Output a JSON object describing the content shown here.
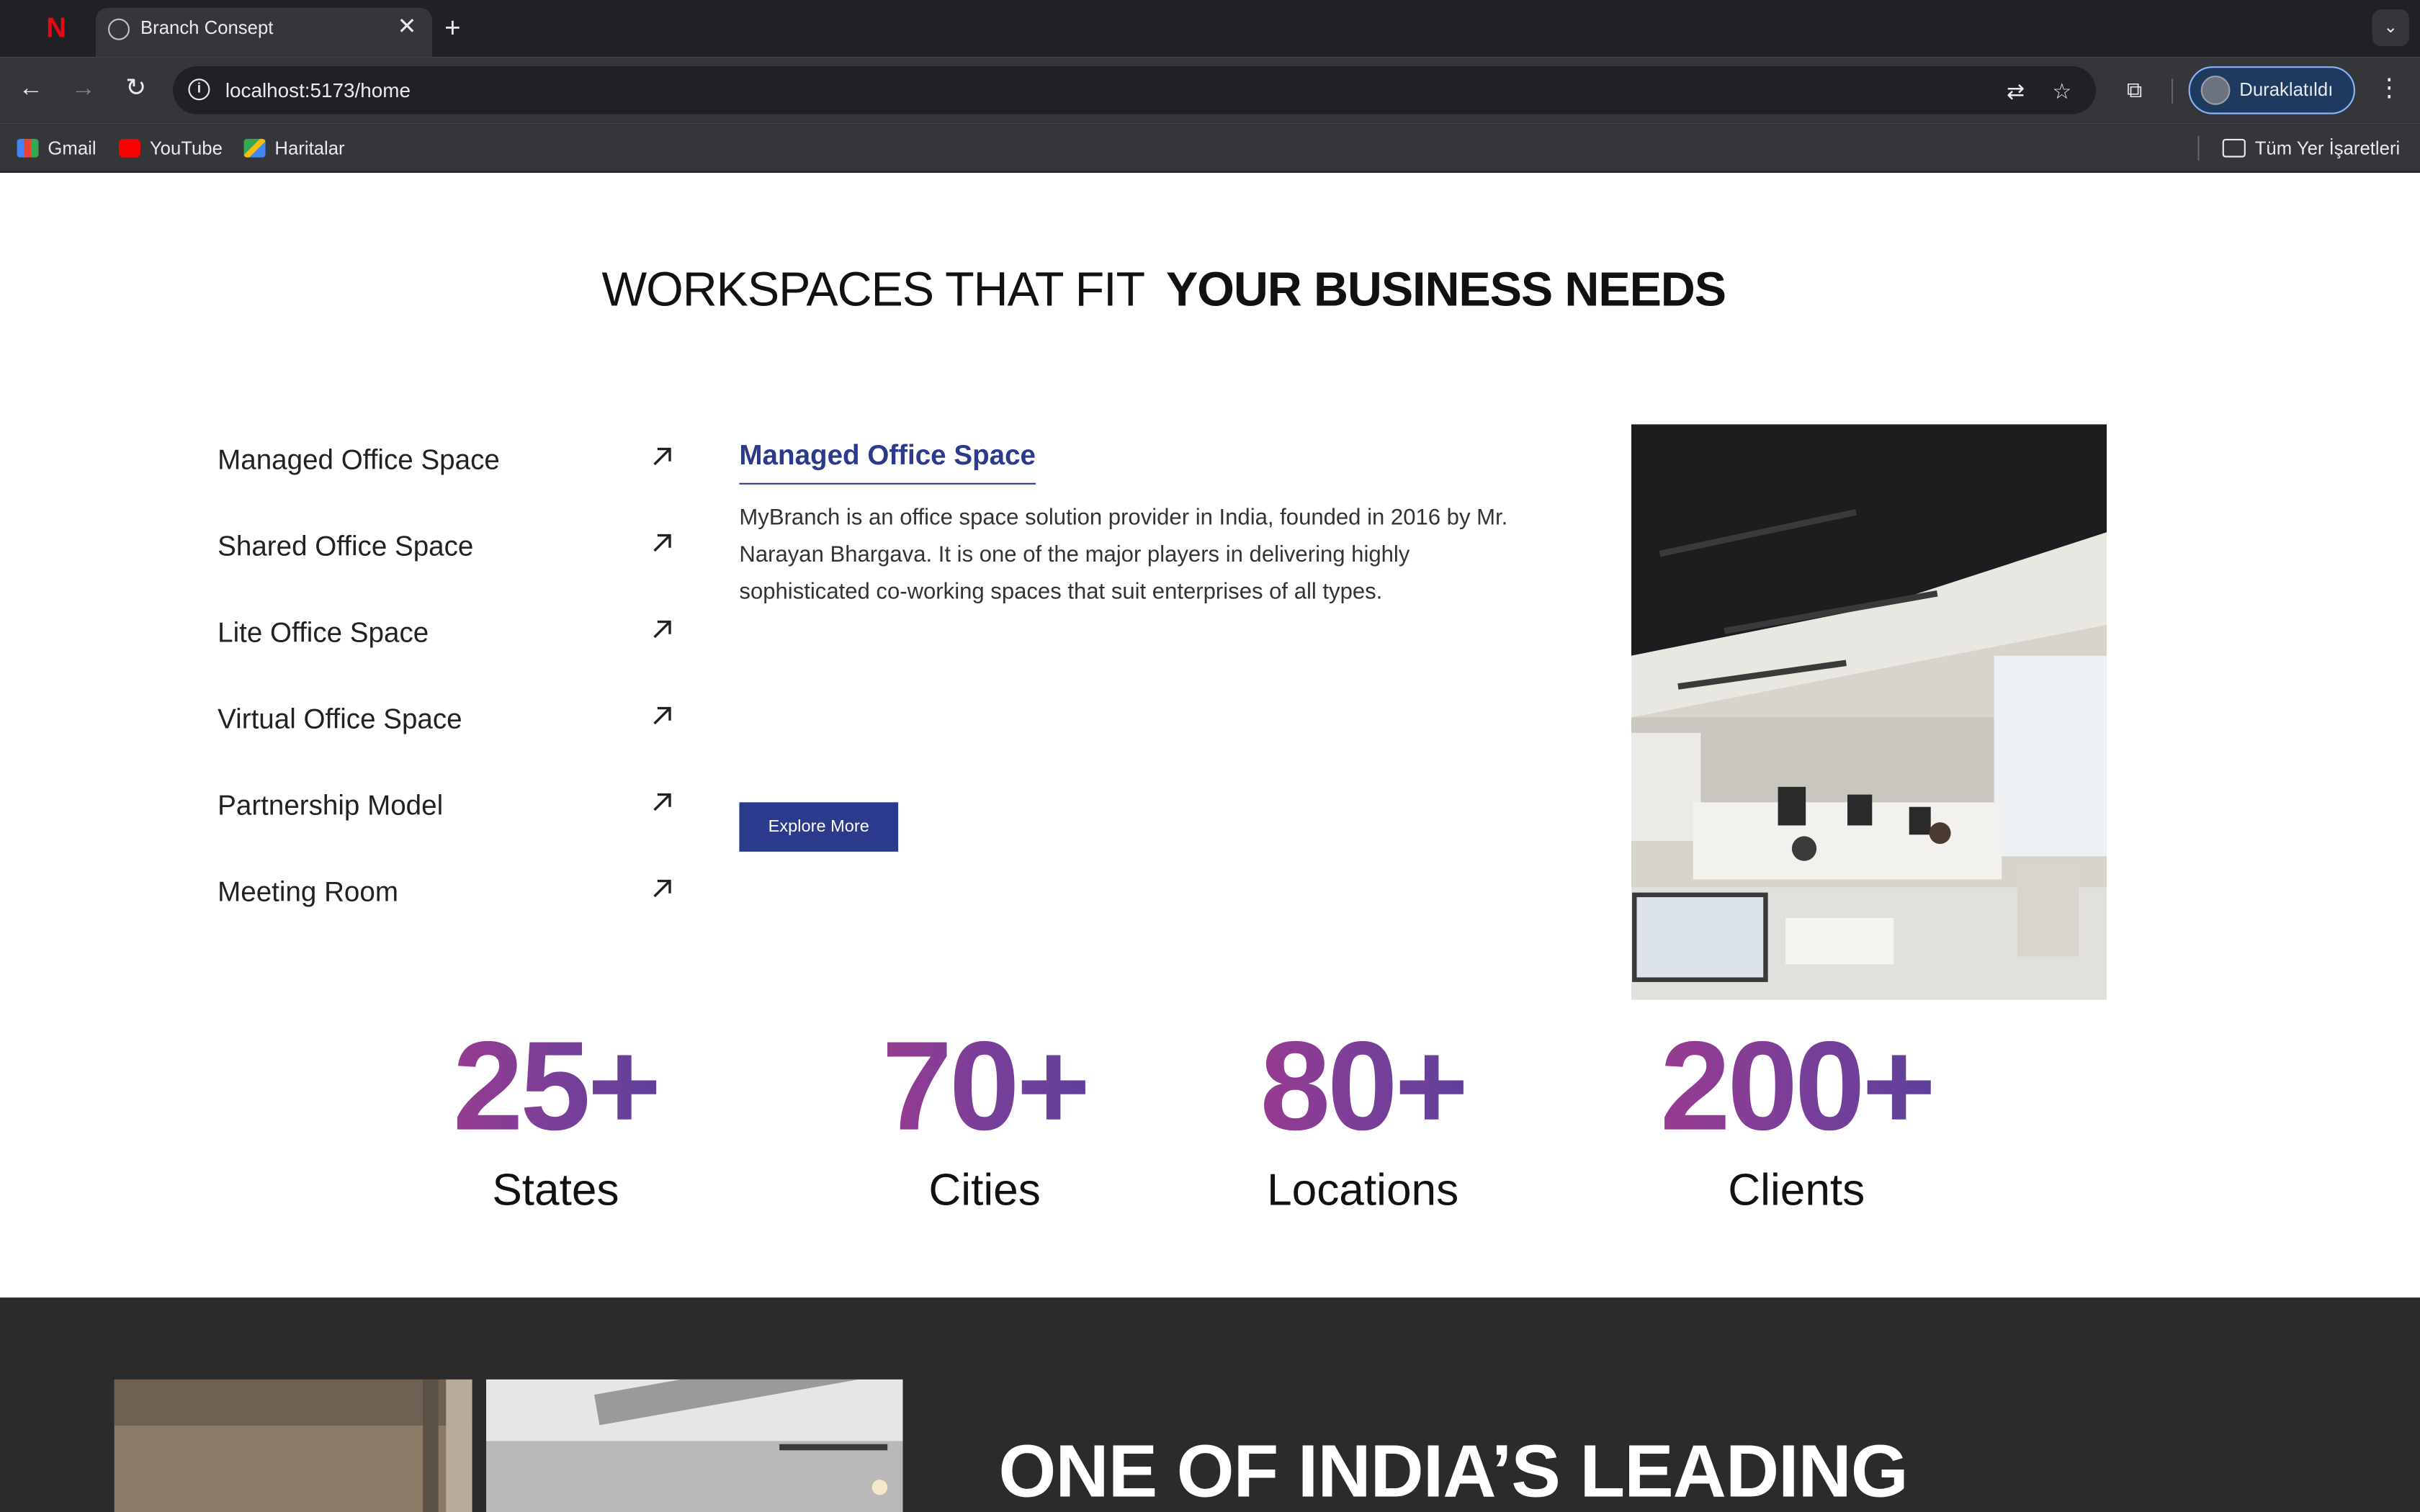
{
  "browser": {
    "tab_title": "Branch Consept",
    "url": "localhost:5173/home",
    "profile_label": "Duraklatıldı",
    "bookmarks": [
      "Gmail",
      "YouTube",
      "Haritalar"
    ],
    "all_bookmarks": "Tüm Yer İşaretleri"
  },
  "page": {
    "headline_light": "WORKSPACES THAT FIT",
    "headline_bold": "YOUR BUSINESS NEEDS",
    "menu": [
      "Managed Office Space",
      "Shared Office Space",
      "Lite Office Space",
      "Virtual Office Space",
      "Partnership Model",
      "Meeting Room"
    ],
    "detail": {
      "title": "Managed Office Space",
      "text": "MyBranch is an office space solution provider in India, founded in 2016 by Mr. Narayan Bhargava. It is one of the major players in delivering highly sophisticated co-working spaces that suit enterprises of all types.",
      "button": "Explore More"
    },
    "stats": [
      {
        "value": "25+",
        "label": "States"
      },
      {
        "value": "70+",
        "label": "Cities"
      },
      {
        "value": "80+",
        "label": "Locations"
      },
      {
        "value": "200+",
        "label": "Clients"
      }
    ],
    "section2_heading": "ONE OF INDIA’S LEADING"
  },
  "colors": {
    "accent": "#2b3a8c",
    "stat_gradient_start": "#a13a8c",
    "stat_gradient_end": "#55409a"
  }
}
